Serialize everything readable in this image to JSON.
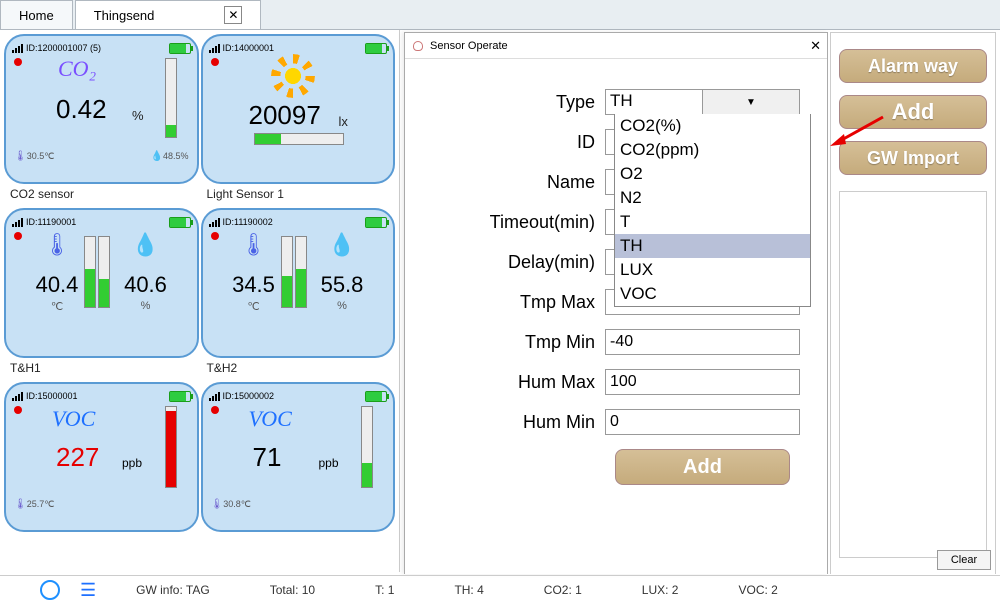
{
  "tabs": {
    "home": "Home",
    "thingsend": "Thingsend"
  },
  "tiles": [
    {
      "id_label": "ID:1200001007 (5)",
      "type_title": "CO₂",
      "value": "0.42",
      "unit": "%",
      "foot_left": "30.5℃",
      "foot_right": "48.5%",
      "label": "CO2 sensor",
      "bar_pct": 15
    },
    {
      "id_label": "ID:14000001",
      "value": "20097",
      "unit": "lx",
      "label": "Light Sensor 1",
      "bar_pct": 30
    },
    {
      "id_label": "ID:11190001",
      "val1": "40.4",
      "unit1": "℃",
      "val2": "40.6",
      "unit2": "%",
      "label": "T&H1",
      "bar1_pct": 55,
      "bar2_pct": 40
    },
    {
      "id_label": "ID:11190002",
      "val1": "34.5",
      "unit1": "℃",
      "val2": "55.8",
      "unit2": "%",
      "label": "T&H2",
      "bar1_pct": 45,
      "bar2_pct": 55
    },
    {
      "id_label": "ID:15000001",
      "type_title": "VOC",
      "value": "227",
      "unit": "ppb",
      "foot_left": "25.7℃",
      "label": "",
      "bar_pct": 95,
      "alarm": true
    },
    {
      "id_label": "ID:15000002",
      "type_title": "VOC",
      "value": "71",
      "unit": "ppb",
      "foot_left": "30.8℃",
      "label": "",
      "bar_pct": 30,
      "alarm": false
    }
  ],
  "dialog": {
    "title": "Sensor Operate",
    "labels": {
      "type": "Type",
      "id": "ID",
      "name": "Name",
      "timeout": "Timeout(min)",
      "delay": "Delay(min)",
      "tmp_max": "Tmp Max",
      "tmp_min": "Tmp Min",
      "hum_max": "Hum Max",
      "hum_min": "Hum Min"
    },
    "type_value": "TH",
    "options": [
      "CO2(%)",
      "CO2(ppm)",
      "O2",
      "N2",
      "T",
      "TH",
      "LUX",
      "VOC"
    ],
    "values": {
      "tmp_min": "-40",
      "hum_max": "100",
      "hum_min": "0"
    },
    "add_button": "Add"
  },
  "right": {
    "alarm_way": "Alarm way",
    "add": "Add",
    "gw_import": "GW Import",
    "clear": "Clear"
  },
  "status": {
    "gw": "GW info: TAG",
    "total": "Total: 10",
    "t": "T: 1",
    "th": "TH: 4",
    "co2": "CO2: 1",
    "lux": "LUX: 2",
    "voc": "VOC: 2"
  }
}
